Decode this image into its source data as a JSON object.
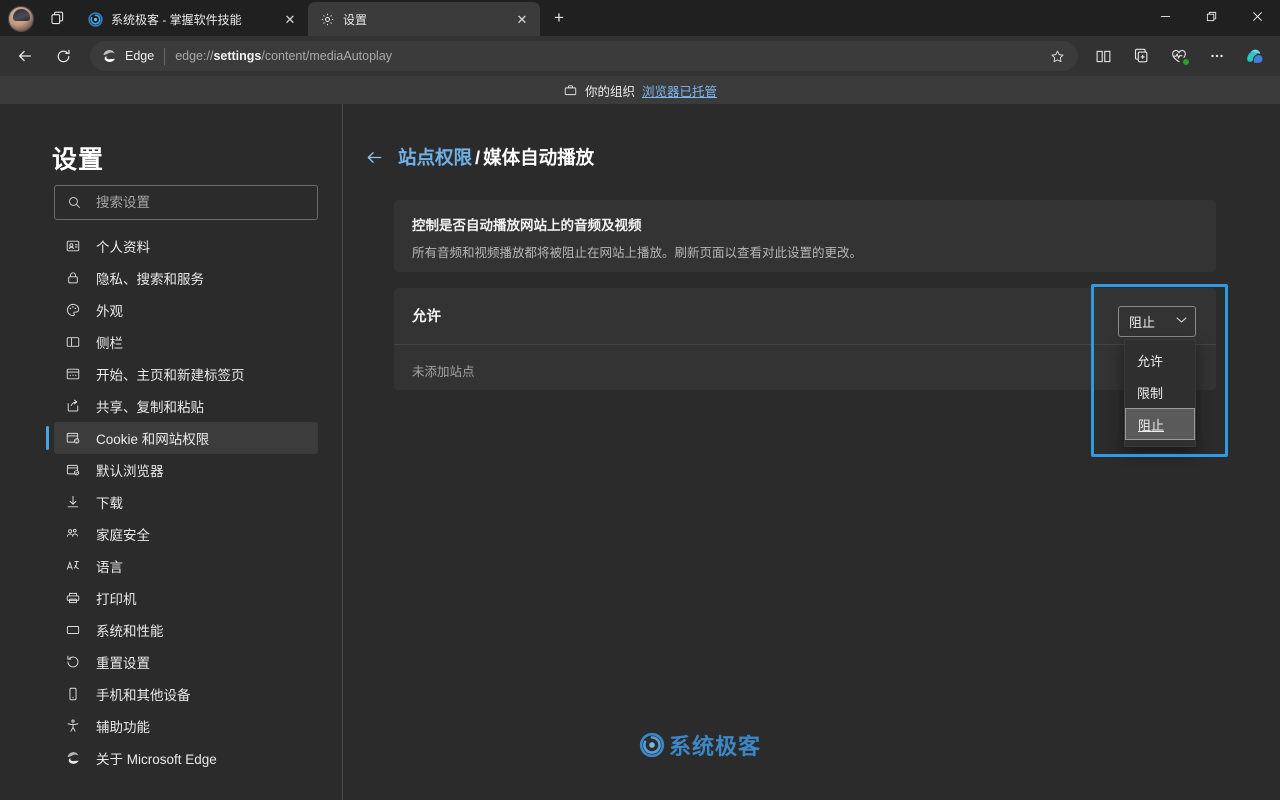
{
  "window": {
    "controls": {
      "minimize": "—",
      "restore": "❐",
      "close": "✕"
    }
  },
  "tabs": {
    "items": [
      {
        "title": "系统极客 - 掌握软件技能",
        "favicon": "swirl-logo-icon",
        "active": false,
        "close_label": "✕"
      },
      {
        "title": "设置",
        "favicon": "gear-icon",
        "active": true,
        "close_label": "✕"
      }
    ],
    "new_tab_label": "+",
    "tab_search_icon": "tab-search-icon",
    "profile_icon": "profile-avatar"
  },
  "toolbar": {
    "back_icon": "back-arrow-icon",
    "refresh_icon": "refresh-icon",
    "edge_label": "Edge",
    "url_prefix": "edge://",
    "url_bold": "settings",
    "url_suffix": "/content/mediaAutoplay",
    "favorite_icon": "star-icon",
    "split_icon": "split-screen-icon",
    "collections_icon": "collections-icon",
    "essentials_icon": "browser-essentials-icon",
    "more_icon": "more-options-icon",
    "copilot_icon": "copilot-icon"
  },
  "org_banner": {
    "icon": "briefcase-icon",
    "text": "你的组织",
    "link": "浏览器已托管"
  },
  "sidebar": {
    "title": "设置",
    "search": {
      "placeholder": "搜索设置",
      "value": "",
      "icon": "search-icon"
    },
    "items": [
      {
        "label": "个人资料",
        "icon": "profile-card-icon",
        "selected": false
      },
      {
        "label": "隐私、搜索和服务",
        "icon": "lock-icon",
        "selected": false
      },
      {
        "label": "外观",
        "icon": "palette-icon",
        "selected": false
      },
      {
        "label": "侧栏",
        "icon": "sidebar-icon",
        "selected": false
      },
      {
        "label": "开始、主页和新建标签页",
        "icon": "home-page-icon",
        "selected": false
      },
      {
        "label": "共享、复制和粘贴",
        "icon": "share-icon",
        "selected": false
      },
      {
        "label": "Cookie 和网站权限",
        "icon": "cookie-permissions-icon",
        "selected": true
      },
      {
        "label": "默认浏览器",
        "icon": "default-browser-icon",
        "selected": false
      },
      {
        "label": "下载",
        "icon": "download-icon",
        "selected": false
      },
      {
        "label": "家庭安全",
        "icon": "family-safety-icon",
        "selected": false
      },
      {
        "label": "语言",
        "icon": "language-icon",
        "selected": false
      },
      {
        "label": "打印机",
        "icon": "printer-icon",
        "selected": false
      },
      {
        "label": "系统和性能",
        "icon": "system-performance-icon",
        "selected": false
      },
      {
        "label": "重置设置",
        "icon": "reset-icon",
        "selected": false
      },
      {
        "label": "手机和其他设备",
        "icon": "phone-icon",
        "selected": false
      },
      {
        "label": "辅助功能",
        "icon": "accessibility-icon",
        "selected": false
      },
      {
        "label": "关于 Microsoft Edge",
        "icon": "edge-logo-icon",
        "selected": false
      }
    ]
  },
  "main": {
    "back_icon": "back-arrow-icon",
    "breadcrumb": {
      "parent": "站点权限",
      "separator": "/",
      "current": "媒体自动播放"
    },
    "setting": {
      "title": "控制是否自动播放网站上的音频及视频",
      "description": "所有音频和视频播放都将被阻止在网站上播放。刷新页面以查看对此设置的更改。"
    },
    "dropdown": {
      "value": "阻止",
      "chevron": "⌄",
      "options": [
        {
          "label": "允许",
          "selected": false
        },
        {
          "label": "限制",
          "selected": false
        },
        {
          "label": "阻止",
          "selected": true
        }
      ]
    },
    "allow_section": {
      "header": "允许",
      "empty_text": "未添加站点"
    }
  },
  "watermark": {
    "text": "系统极客",
    "icon": "swirl-logo-icon"
  },
  "colors": {
    "accent_blue": "#2f9ae0",
    "link_blue": "#6fb2e8",
    "window_bg": "#202020",
    "page_bg": "#2b2b2b",
    "card_bg": "#333333",
    "selected_nav_bg": "#3c3c3c"
  }
}
